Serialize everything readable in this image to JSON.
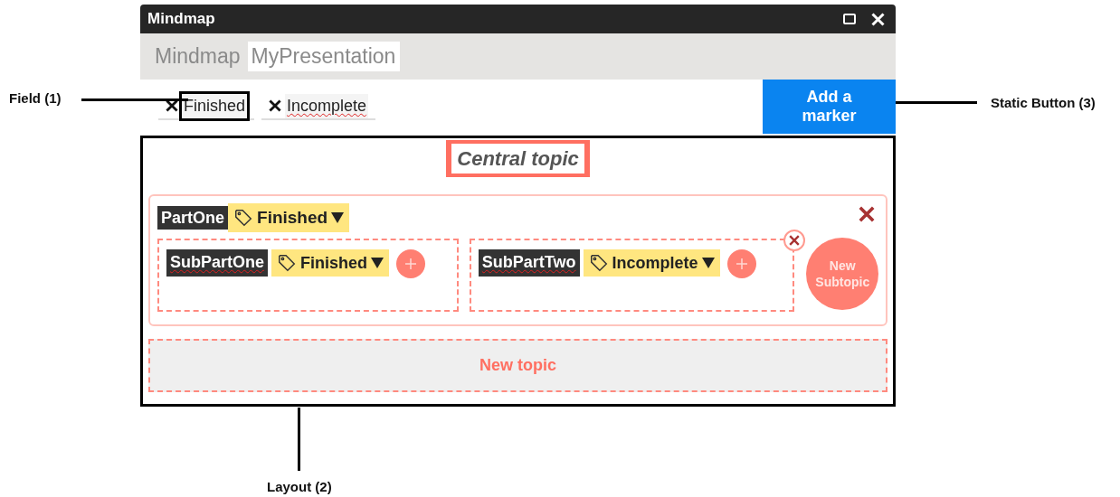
{
  "window": {
    "title": "Mindmap"
  },
  "header": {
    "label": "Mindmap",
    "name_field": "MyPresentation"
  },
  "markers": [
    {
      "label": "Finished",
      "highlighted": true,
      "misspelled": false
    },
    {
      "label": "Incomplete",
      "highlighted": false,
      "misspelled": true
    }
  ],
  "add_marker_button": "Add a marker",
  "central_topic": "Central topic",
  "topics": [
    {
      "name": "PartOne",
      "marker": "Finished",
      "subtopics": [
        {
          "name": "SubPartOne",
          "marker": "Finished",
          "misspelled": true,
          "delete_visible": false
        },
        {
          "name": "SubPartTwo",
          "marker": "Incomplete",
          "misspelled": true,
          "delete_visible": true
        }
      ],
      "new_subtopic_button": "New Subtopic"
    }
  ],
  "new_topic_button": "New topic",
  "annotations": [
    {
      "label": "Field (1)"
    },
    {
      "label": "Layout (2)"
    },
    {
      "label": "Static Button (3)"
    }
  ]
}
